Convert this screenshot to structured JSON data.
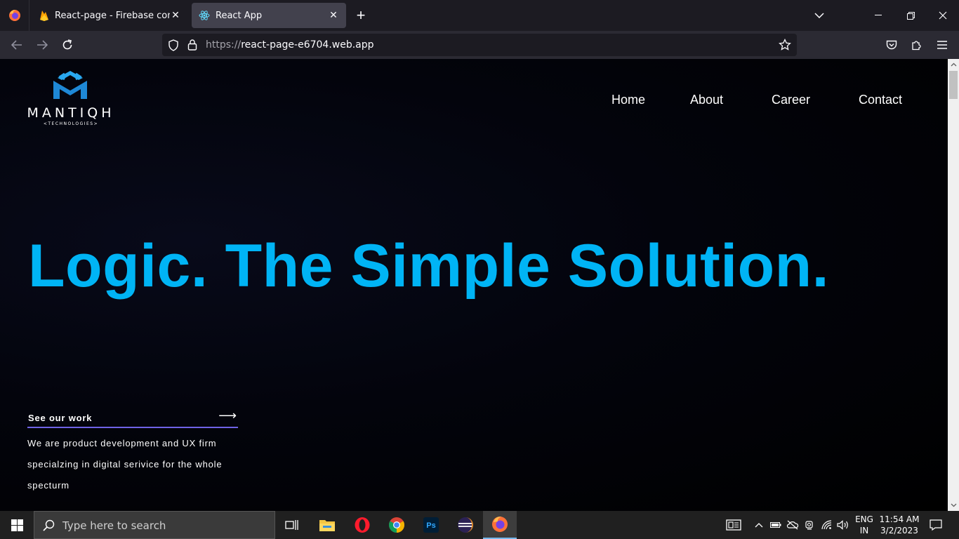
{
  "browser": {
    "tabs": [
      {
        "title": "React-page - Firebase console",
        "icon": "firebase-icon"
      },
      {
        "title": "React App",
        "icon": "react-icon",
        "active": true
      }
    ],
    "url_protocol": "https://",
    "url_host": "react-page-e6704.web.app"
  },
  "site": {
    "logo_text": "MANTIQH",
    "logo_subtext": "<TECHNOLOGIES>",
    "nav": [
      "Home",
      "About",
      "Career",
      "Contact"
    ],
    "hero_title": "Logic. The Simple Solution.",
    "cta_label": "See our work",
    "description": "We are product development and UX firm specialzing in digital serivice for the whole specturm",
    "accent_color": "#00b4f5",
    "underline_color": "#6e62e5"
  },
  "taskbar": {
    "search_placeholder": "Type here to search",
    "apps": [
      "task-view-icon",
      "file-explorer-icon",
      "opera-icon",
      "chrome-icon",
      "photoshop-icon",
      "eclipse-icon",
      "firefox-icon"
    ],
    "photoshop_label": "Ps",
    "lang_line1": "ENG",
    "lang_line2": "IN",
    "time": "11:54 AM",
    "date": "3/2/2023"
  }
}
